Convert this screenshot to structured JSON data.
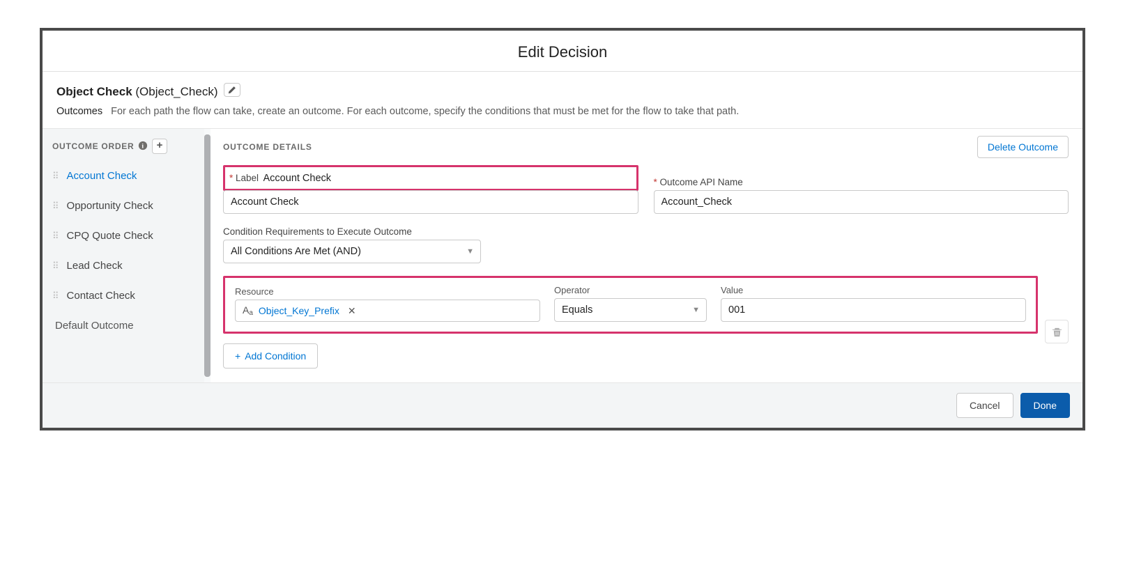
{
  "header": {
    "title": "Edit Decision"
  },
  "decision": {
    "name": "Object Check",
    "api": "(Object_Check)"
  },
  "outcomes_section": {
    "label": "Outcomes",
    "description": "For each path the flow can take, create an outcome. For each outcome, specify the conditions that must be met for the flow to take that path."
  },
  "sidebar": {
    "header": "OUTCOME ORDER",
    "add_label": "+",
    "items": [
      {
        "label": "Account Check",
        "active": true
      },
      {
        "label": "Opportunity Check",
        "active": false
      },
      {
        "label": "CPQ Quote Check",
        "active": false
      },
      {
        "label": "Lead Check",
        "active": false
      },
      {
        "label": "Contact Check",
        "active": false
      }
    ],
    "default_label": "Default Outcome"
  },
  "details": {
    "header": "OUTCOME DETAILS",
    "delete_label": "Delete Outcome",
    "label_field": {
      "label": "Label",
      "value": "Account Check"
    },
    "api_field": {
      "label": "Outcome API Name",
      "value": "Account_Check"
    },
    "requirements": {
      "label": "Condition Requirements to Execute Outcome",
      "value": "All Conditions Are Met (AND)"
    },
    "condition": {
      "resource_label": "Resource",
      "resource_value": "Object_Key_Prefix",
      "operator_label": "Operator",
      "operator_value": "Equals",
      "value_label": "Value",
      "value_value": "001"
    },
    "add_condition_label": "Add Condition"
  },
  "footer": {
    "cancel": "Cancel",
    "done": "Done"
  }
}
